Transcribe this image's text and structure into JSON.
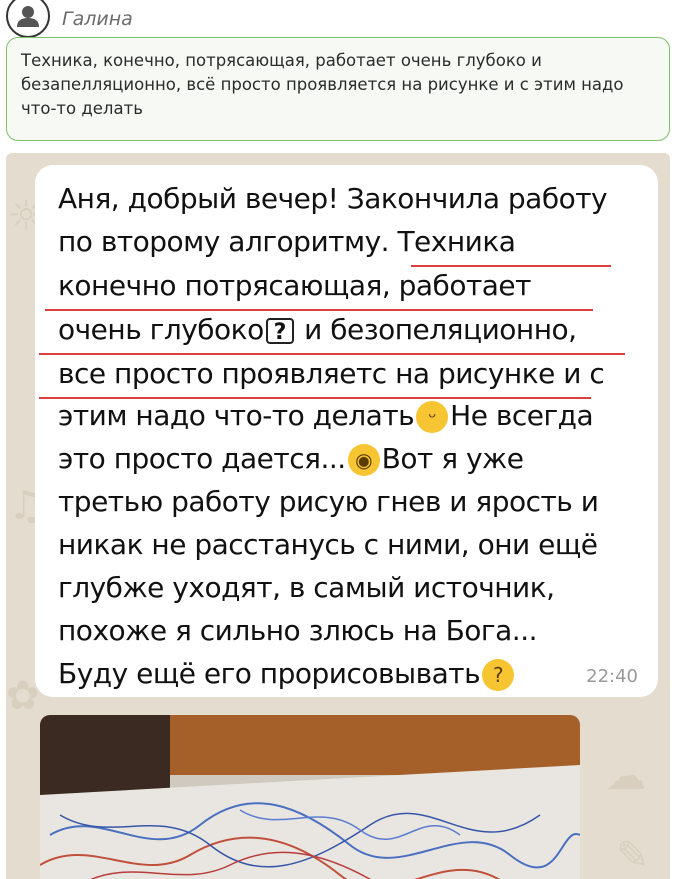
{
  "comment": {
    "author": "Галина",
    "text": "Техника, конечно, потрясающая, работает очень глубоко и безапелляционно, всё просто проявляется на рисунке и с этим надо что-то делать"
  },
  "message": {
    "lines": [
      "Аня, добрый вечер! Закончила работу",
      "по второму алгоритму. Техника",
      "конечно потрясающая, работает",
      "очень глубоко",
      "и безопеляционно,",
      "все просто проявляетс на рисунке и с",
      "этим надо что-то делать",
      "Не всегда",
      "это просто дается...",
      "Вот я уже",
      "третью работу рисую гнев и ярость и",
      "никак не расстанусь с ними, они ещё",
      "глубже уходят, в самый источник,",
      "похоже я сильно злюсь на Бога...",
      "Буду ещё его прорисовывать"
    ],
    "question_box": "?",
    "time": "22:40",
    "emojis": [
      "grinning-face",
      "flushed-face",
      "thinking-face"
    ]
  },
  "colors": {
    "quote_border": "#7fc16a",
    "underline": "#d9403a",
    "chat_background": "#e4dccf"
  }
}
